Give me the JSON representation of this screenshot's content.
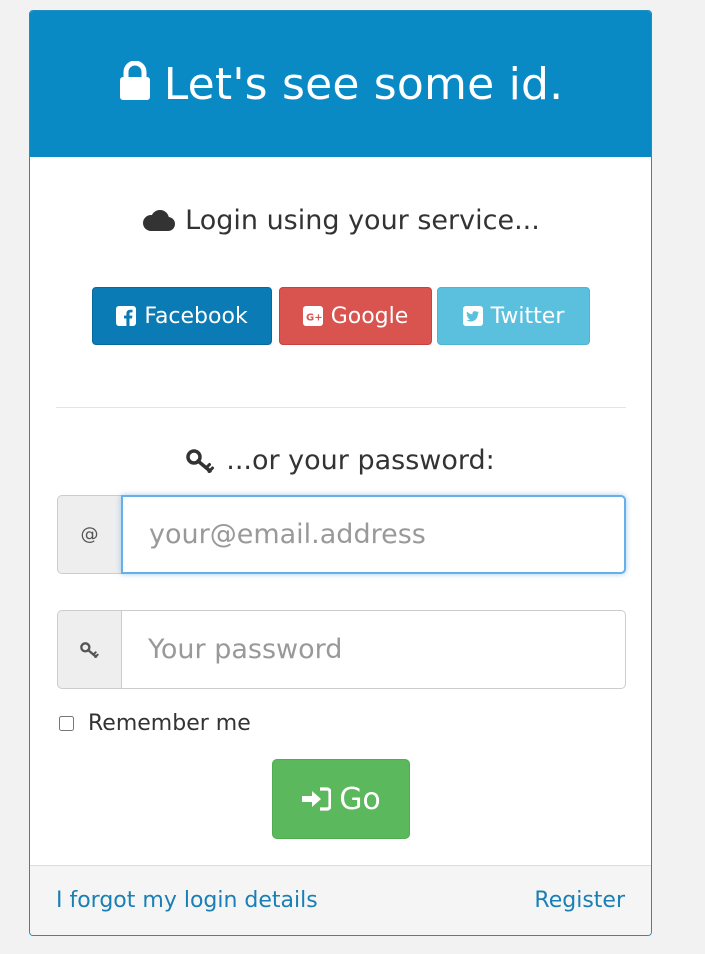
{
  "header": {
    "title": "Let's see some id.",
    "icon": "lock-icon",
    "background_color": "#0a8ac5"
  },
  "services": {
    "heading": "Login using your service...",
    "heading_icon": "cloud-icon",
    "buttons": [
      {
        "label": "Facebook",
        "icon": "facebook-square-icon",
        "color": "#0a7bb5"
      },
      {
        "label": "Google",
        "icon": "google-plus-square-icon",
        "color": "#d9534f"
      },
      {
        "label": "Twitter",
        "icon": "twitter-square-icon",
        "color": "#5bc0de"
      }
    ]
  },
  "password_section": {
    "heading": "...or your password:",
    "heading_icon": "key-icon"
  },
  "email": {
    "addon": "@",
    "placeholder": "your@email.address",
    "value": ""
  },
  "password": {
    "addon_icon": "key-icon",
    "placeholder": "Your password",
    "value": ""
  },
  "remember": {
    "label": "Remember me",
    "checked": false
  },
  "submit": {
    "label": "Go",
    "icon": "sign-in-icon",
    "color": "#5cb85c"
  },
  "footer": {
    "forgot_label": "I forgot my login details",
    "register_label": "Register",
    "link_color": "#1a7fb5"
  }
}
